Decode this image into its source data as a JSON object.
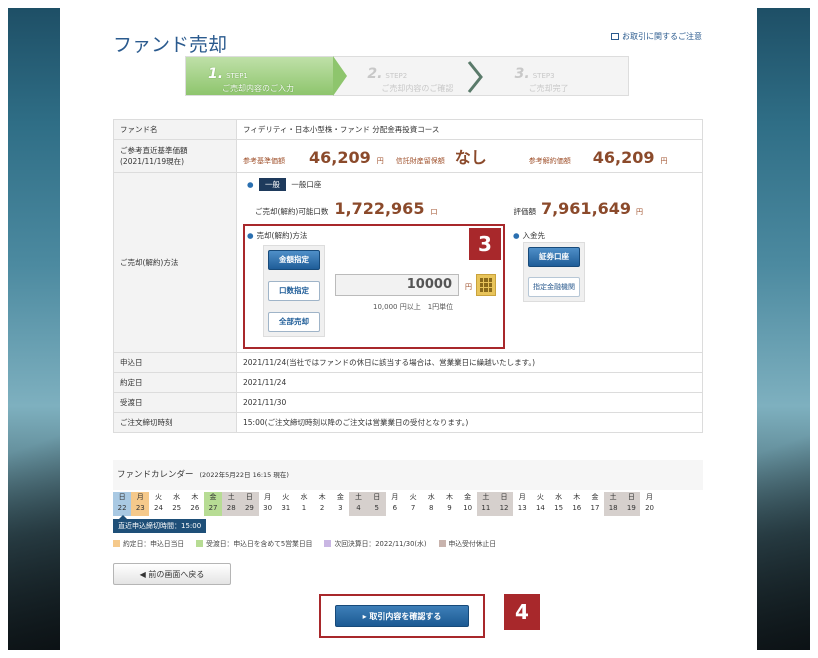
{
  "page_title": "ファンド売却",
  "notice_link": "お取引に関するご注意",
  "steps": [
    {
      "num": "1.",
      "tag": "STEP1",
      "label": "ご売却内容のご入力"
    },
    {
      "num": "2.",
      "tag": "STEP2",
      "label": "ご売却内容のご確認"
    },
    {
      "num": "3.",
      "tag": "STEP3",
      "label": "ご売却完了"
    }
  ],
  "fund": {
    "name_label": "ファンド名",
    "name_value": "フィデリティ・日本小型株・ファンド 分配金再投資コース"
  },
  "reference": {
    "label_line1": "ご参考直近基準価額",
    "label_line2": "(2021/11/19現在)",
    "base_price_label": "参考基準価額",
    "base_price": "46,209",
    "base_unit": "円",
    "trust_fee_label": "信託財産留保額",
    "trust_fee": "なし",
    "contract_label": "参考解約価額",
    "contract_price": "46,209",
    "contract_unit": "円"
  },
  "account": {
    "badge": "一般",
    "label": "一般口座",
    "available_label": "ご売却(解約)可能口数",
    "available_qty": "1,722,965",
    "available_unit": "口",
    "valuation_label": "評価額",
    "valuation": "7,961,649",
    "valuation_unit": "円"
  },
  "method": {
    "row_label": "ご売却(解約)方法",
    "heading": "売却(解約)方法",
    "btn_amount": "金額指定",
    "btn_units": "口数指定",
    "btn_all": "全部売却",
    "amount_value": "10000",
    "amount_unit": "円",
    "amount_note": "10,000 円以上　1円単位",
    "badge_num": "3"
  },
  "deposit": {
    "heading": "入金先",
    "btn_securities": "証券口座",
    "btn_bank": "指定金融機関"
  },
  "dates": [
    {
      "label": "申込日",
      "value": "2021/11/24(当社ではファンドの休日に該当する場合は、営業業日に繰越いたします。)"
    },
    {
      "label": "約定日",
      "value": "2021/11/24"
    },
    {
      "label": "受渡日",
      "value": "2021/11/30"
    },
    {
      "label": "ご注文締切時刻",
      "value": "15:00(ご注文締切時刻以降のご注文は営業業日の受付となります。)"
    }
  ],
  "calendar": {
    "title": "ファンドカレンダー",
    "as_of": "(2022年5月22日 16:15 現在)",
    "days": [
      {
        "w": "日",
        "d": "22",
        "c": "blue"
      },
      {
        "w": "月",
        "d": "23",
        "c": "orange"
      },
      {
        "w": "火",
        "d": "24",
        "c": ""
      },
      {
        "w": "水",
        "d": "25",
        "c": ""
      },
      {
        "w": "木",
        "d": "26",
        "c": ""
      },
      {
        "w": "金",
        "d": "27",
        "c": "green"
      },
      {
        "w": "土",
        "d": "28",
        "c": "gray"
      },
      {
        "w": "日",
        "d": "29",
        "c": "gray"
      },
      {
        "w": "月",
        "d": "30",
        "c": ""
      },
      {
        "w": "火",
        "d": "31",
        "c": ""
      },
      {
        "w": "水",
        "d": "1",
        "c": ""
      },
      {
        "w": "木",
        "d": "2",
        "c": ""
      },
      {
        "w": "金",
        "d": "3",
        "c": ""
      },
      {
        "w": "土",
        "d": "4",
        "c": "gray"
      },
      {
        "w": "日",
        "d": "5",
        "c": "gray"
      },
      {
        "w": "月",
        "d": "6",
        "c": ""
      },
      {
        "w": "火",
        "d": "7",
        "c": ""
      },
      {
        "w": "水",
        "d": "8",
        "c": ""
      },
      {
        "w": "木",
        "d": "9",
        "c": ""
      },
      {
        "w": "金",
        "d": "10",
        "c": ""
      },
      {
        "w": "土",
        "d": "11",
        "c": "gray"
      },
      {
        "w": "日",
        "d": "12",
        "c": "gray"
      },
      {
        "w": "月",
        "d": "13",
        "c": ""
      },
      {
        "w": "火",
        "d": "14",
        "c": ""
      },
      {
        "w": "水",
        "d": "15",
        "c": ""
      },
      {
        "w": "木",
        "d": "16",
        "c": ""
      },
      {
        "w": "金",
        "d": "17",
        "c": ""
      },
      {
        "w": "土",
        "d": "18",
        "c": "gray"
      },
      {
        "w": "日",
        "d": "19",
        "c": "gray"
      },
      {
        "w": "月",
        "d": "20",
        "c": ""
      }
    ],
    "deadline": "直近申込締切時間：15:00",
    "legend": [
      {
        "color": "#f5c98b",
        "label": "約定日：申込日当日"
      },
      {
        "color": "#b7dc94",
        "label": "受渡日：申込日を含めて5営業日目"
      },
      {
        "color": "#c9b6e3",
        "label": "次回決算日：2022/11/30(水)"
      },
      {
        "color": "#c8b3ad",
        "label": "申込受付休止日"
      }
    ]
  },
  "buttons": {
    "back": "◀  前の画面へ戻る",
    "confirm": "▸ 取引内容を確認する",
    "confirm_badge": "4"
  },
  "colors": {
    "accent": "#2a5a8e",
    "highlight_red": "#a8282b",
    "step_active": "#8ec56d"
  }
}
